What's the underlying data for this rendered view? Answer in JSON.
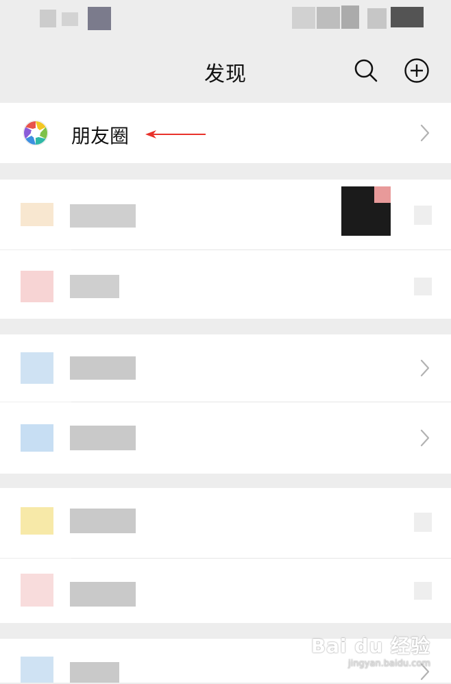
{
  "nav": {
    "title": "发现"
  },
  "moments": {
    "label": "朋友圈"
  },
  "watermark": {
    "brand": "Bai du 经验",
    "url": "jingyan.baidu.com"
  },
  "icons": {
    "search": "search-icon",
    "add": "add-circle-icon",
    "moments": "aperture-icon",
    "chevron": "chevron-right-icon",
    "arrow": "red-arrow-annotation"
  },
  "colors": {
    "background": "#ededed",
    "row": "#ffffff",
    "annotation_arrow": "#e8312a"
  }
}
